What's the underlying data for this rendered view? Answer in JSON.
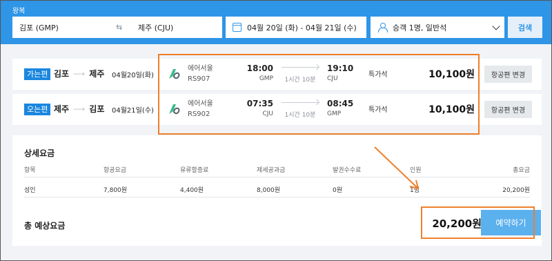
{
  "search_bar": {
    "trip_type": "왕복",
    "origin": "김포 (GMP)",
    "destination": "제주 (CJU)",
    "dates": "04월 20일 (화) - 04월 21일 (수)",
    "passengers": "승객 1명, 일반석",
    "search_label": "검색"
  },
  "flights": [
    {
      "badge": "가는편",
      "from": "김포",
      "to": "제주",
      "date": "04월20일(화)",
      "airline": "에어서울",
      "flight_no": "RS907",
      "dep_time": "18:00",
      "dep_code": "GMP",
      "duration": "1시간 10분",
      "arr_time": "19:10",
      "arr_code": "CJU",
      "seat_class": "특가석",
      "price": "10,100원",
      "change_label": "항공편 변경"
    },
    {
      "badge": "오는편",
      "from": "제주",
      "to": "김포",
      "date": "04월21일(수)",
      "airline": "에어서울",
      "flight_no": "RS902",
      "dep_time": "07:35",
      "dep_code": "CJU",
      "duration": "1시간 10분",
      "arr_time": "08:45",
      "arr_code": "GMP",
      "seat_class": "특가석",
      "price": "10,100원",
      "change_label": "항공편 변경"
    }
  ],
  "fare_detail": {
    "title": "상세요금",
    "headers": [
      "항목",
      "항공요금",
      "유류할증료",
      "제세공과금",
      "발권수수료",
      "인원",
      "총요금"
    ],
    "row": [
      "성인",
      "7,800원",
      "4,400원",
      "8,000원",
      "0원",
      "1명",
      "20,200원"
    ],
    "total_label": "총 예상요금",
    "total_price": "20,200원",
    "book_label": "예약하기"
  },
  "colors": {
    "brand_blue": "#2f95e6",
    "badge_blue": "#1a86de",
    "book_button": "#5bb0ee",
    "highlight_orange": "#ef7f2a",
    "airline_logo_green": "#3dbd8a"
  }
}
